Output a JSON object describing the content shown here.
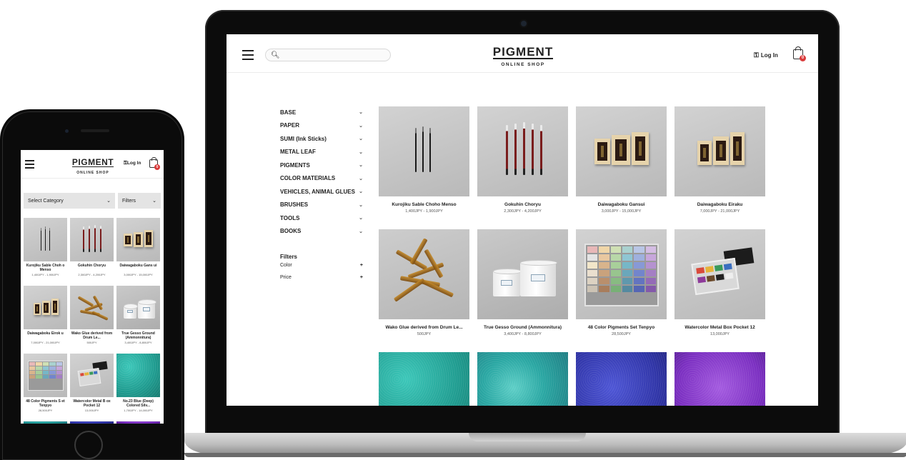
{
  "desktop": {
    "header": {
      "logo": "PIGMENT",
      "logo_sub": "ONLINE SHOP",
      "search_placeholder": "",
      "login": "Log In",
      "cart_count": "0"
    },
    "categories": [
      "BASE",
      "PAPER",
      "SUMI (Ink Sticks)",
      "METAL LEAF",
      "PIGMENTS",
      "COLOR MATERIALS",
      "VEHICLES, ANIMAL GLUES",
      "BRUSHES",
      "TOOLS",
      "BOOKS"
    ],
    "filters_heading": "Filters",
    "filters": [
      "Color",
      "Price"
    ],
    "products": [
      {
        "name": "Kurojiku Sable Choho Menso",
        "price": "1,400JPY - 1,900JPY"
      },
      {
        "name": "Gokuhin Choryu",
        "price": "2,300JPY - 4,200JPY"
      },
      {
        "name": "Daiwagaboku Gansui",
        "price": "3,000JPY - 15,000JPY"
      },
      {
        "name": "Daiwagaboku Eiraku",
        "price": "7,000JPY - 21,000JPY"
      },
      {
        "name": "Wako Glue derived from Drum Le...",
        "price": "500JPY"
      },
      {
        "name": "True Gesso Ground (Ammonnitura)",
        "price": "3,400JPY - 8,800JPY"
      },
      {
        "name": "48 Color Pigments Set Tenpyo",
        "price": "28,500JPY"
      },
      {
        "name": "Watercolor Metal Box Pocket 12",
        "price": "13,000JPY"
      }
    ]
  },
  "mobile": {
    "header": {
      "logo": "PIGMENT",
      "logo_sub": "ONLINE SHOP",
      "login": "Log In",
      "cart_count": "0"
    },
    "category_select": "Select Category",
    "filters_select": "Filters",
    "products": [
      {
        "name": "Kurojiku Sable Choh o Menso",
        "price": "1,400JPY - 1,900JPY"
      },
      {
        "name": "Gokuhin Choryu",
        "price": "2,300JPY - 4,200JPY"
      },
      {
        "name": "Daiwagaboku Gans ui",
        "price": "3,000JPY - 15,000JPY"
      },
      {
        "name": "Daiwagaboku Eirok u",
        "price": "7,000JPY - 21,000JPY"
      },
      {
        "name": "Wako Glue derived from Drum Le...",
        "price": "500JPY"
      },
      {
        "name": "True Gesso Ground (Ammonnitura)",
        "price": "3,400JPY - 8,800JPY"
      },
      {
        "name": "48 Color Pigments S et Tenpyo",
        "price": "28,500JPY"
      },
      {
        "name": "Watercolor Metal B ox Pocket 12",
        "price": "13,000JPY"
      },
      {
        "name": "No.23 Blue (Deep) Colored Silv...",
        "price": "1,700JPY - 14,000JPY"
      }
    ]
  }
}
